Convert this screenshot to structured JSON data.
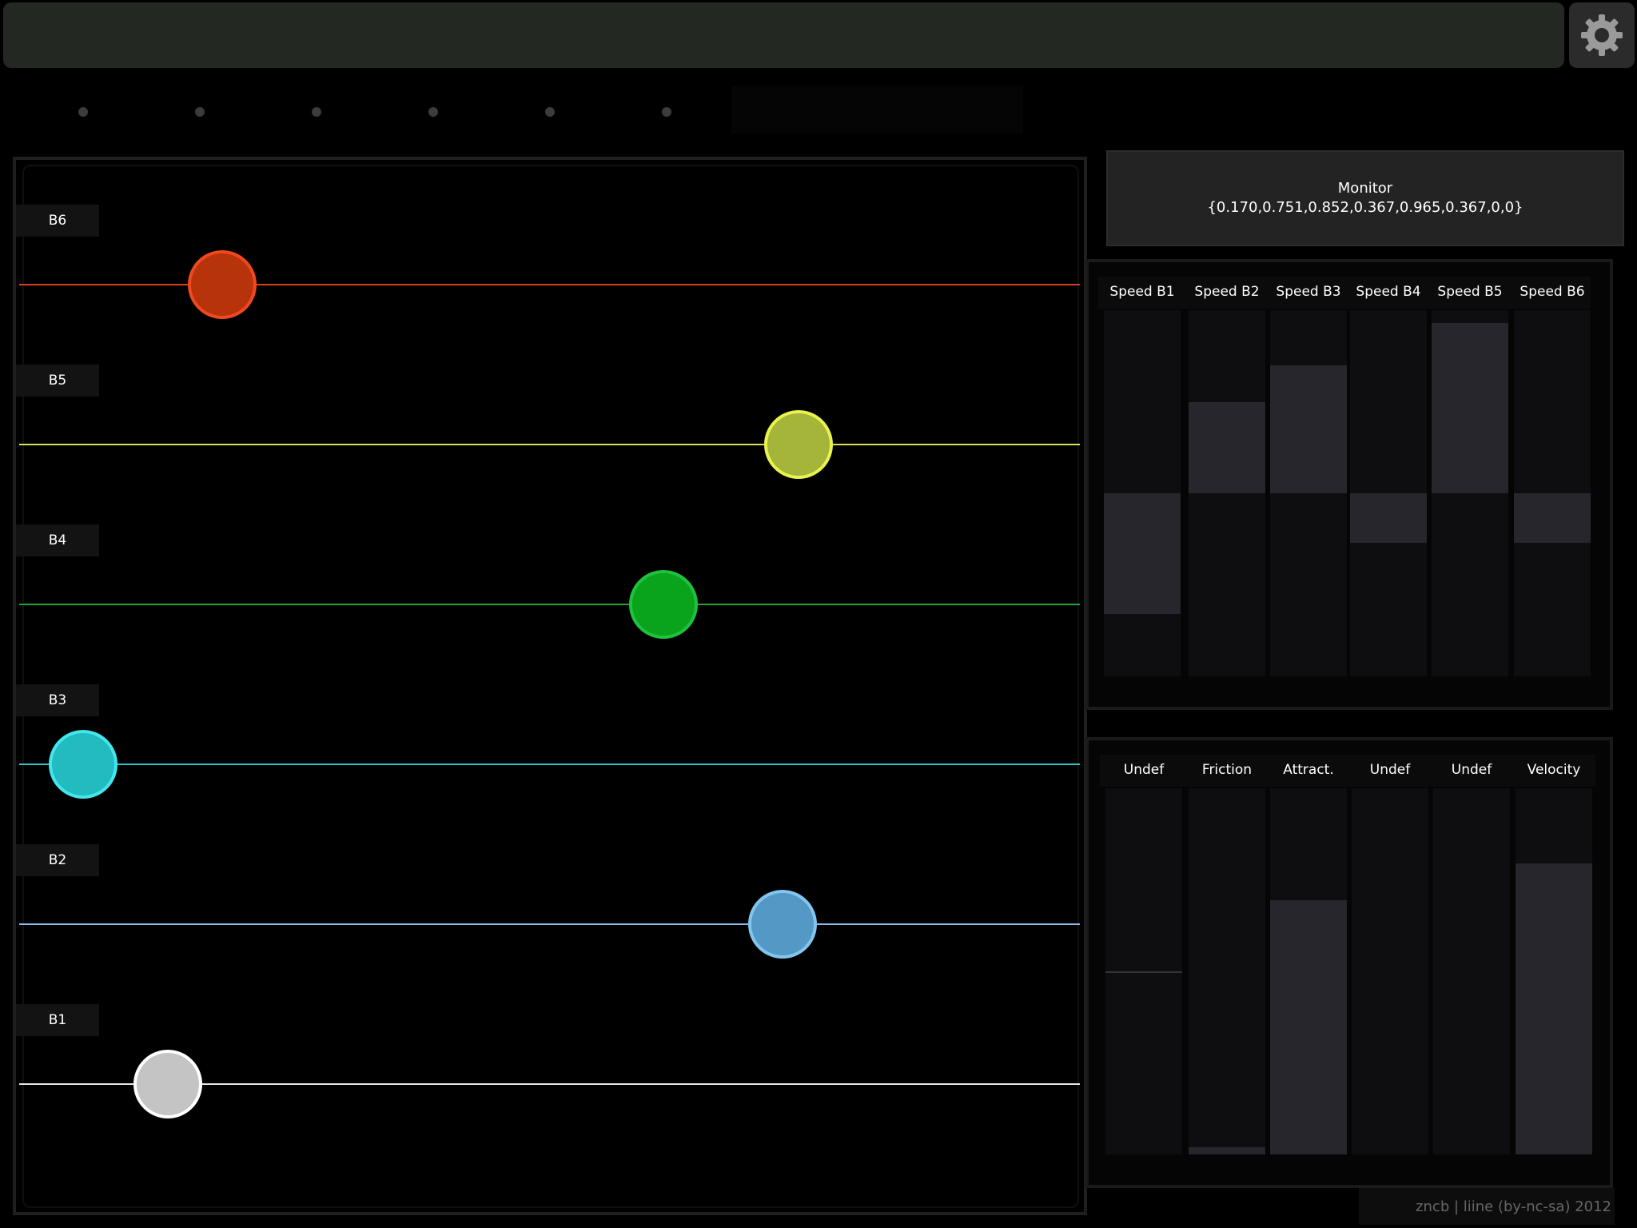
{
  "header": {
    "settings_icon": "gear-icon"
  },
  "pages": {
    "count": 6
  },
  "lanes": [
    {
      "label": "B6",
      "color": "#d8401e",
      "ball_fill": "#b7330b",
      "ball_border": "#f0481f",
      "value": 0.17
    },
    {
      "label": "B5",
      "color": "#d9e35a",
      "ball_fill": "#a4b53a",
      "ball_border": "#e9f34c",
      "value": 0.751
    },
    {
      "label": "B4",
      "color": "#22a33a",
      "ball_fill": "#0aa31c",
      "ball_border": "#1fc23c",
      "value": 0.615
    },
    {
      "label": "B3",
      "color": "#35c2c6",
      "ball_fill": "#22bbbf",
      "ball_border": "#43e6ee",
      "value": 0.03
    },
    {
      "label": "B2",
      "color": "#8bbbe6",
      "ball_fill": "#5498c6",
      "ball_border": "#82c6f0",
      "value": 0.735
    },
    {
      "label": "B1",
      "color": "#e6e6e6",
      "ball_fill": "#c4c4c4",
      "ball_border": "#ffffff",
      "value": 0.115
    }
  ],
  "monitor": {
    "title": "Monitor",
    "value": "{0.170,0.751,0.852,0.367,0.965,0.367,0,0}"
  },
  "speed_faders": [
    {
      "label": "Speed B1",
      "value": -0.33
    },
    {
      "label": "Speed B2",
      "value": 0.25
    },
    {
      "label": "Speed B3",
      "value": 0.35
    },
    {
      "label": "Speed B4",
      "value": -0.135
    },
    {
      "label": "Speed B5",
      "value": 0.465
    },
    {
      "label": "Speed B6",
      "value": -0.135
    }
  ],
  "param_faders": [
    {
      "label": "Undef",
      "value": 0.0,
      "marker": 0.5
    },
    {
      "label": "Friction",
      "value": 0.02
    },
    {
      "label": "Attract.",
      "value": 0.695
    },
    {
      "label": "Undef",
      "value": 0.0
    },
    {
      "label": "Undef",
      "value": 0.0
    },
    {
      "label": "Velocity",
      "value": 0.795
    }
  ],
  "footer": {
    "credit": "zncb | liine (by-nc-sa) 2012"
  }
}
